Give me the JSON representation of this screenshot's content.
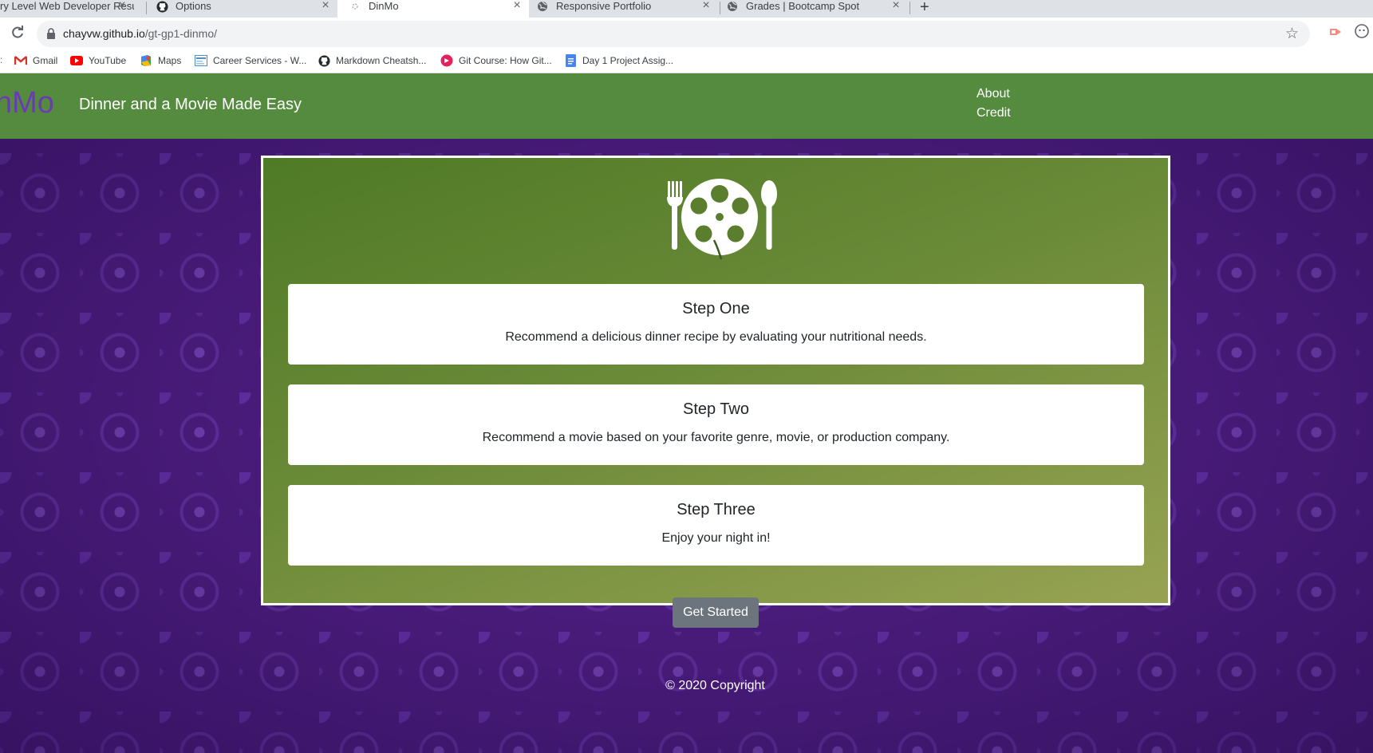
{
  "browser": {
    "tabs": [
      {
        "title": "ry Level Web Developer Resu",
        "favicon": "document-icon",
        "active": false
      },
      {
        "title": "Options",
        "favicon": "github-icon",
        "active": false
      },
      {
        "title": "DinMo",
        "favicon": "loading-icon",
        "active": true
      },
      {
        "title": "Responsive Portfolio",
        "favicon": "globe-icon",
        "active": false
      },
      {
        "title": "Grades | Bootcamp Spot",
        "favicon": "globe-icon",
        "active": false
      }
    ],
    "new_tab_symbol": "+",
    "close_symbol": "×",
    "url_host": "chayvw.github.io",
    "url_path": "/gt-gp1-dinmo/",
    "bookmarks": [
      {
        "label": "Gmail",
        "icon": "gmail-icon"
      },
      {
        "label": "YouTube",
        "icon": "youtube-icon"
      },
      {
        "label": "Maps",
        "icon": "maps-icon"
      },
      {
        "label": "Career Services - W...",
        "icon": "career-icon"
      },
      {
        "label": "Markdown Cheatsh...",
        "icon": "github-icon"
      },
      {
        "label": "Git Course: How Git...",
        "icon": "course-icon"
      },
      {
        "label": "Day 1 Project Assig...",
        "icon": "docs-icon"
      }
    ]
  },
  "navbar": {
    "brand": "nMo",
    "tagline": "Dinner and a Movie Made Easy",
    "links": [
      "About",
      "Credit"
    ]
  },
  "steps": [
    {
      "title": "Step One",
      "text": "Recommend a delicious dinner recipe by evaluating your nutritional needs."
    },
    {
      "title": "Step Two",
      "text": "Recommend a movie based on your favorite genre, movie, or production company."
    },
    {
      "title": "Step Three",
      "text": "Enjoy your night in!"
    }
  ],
  "cta_label": "Get Started",
  "footer": "© 2020 Copyright",
  "colors": {
    "navbar": "#558b3f",
    "brand": "#6a3bb5",
    "background": "#4a1c7c",
    "button": "#6c757d"
  }
}
